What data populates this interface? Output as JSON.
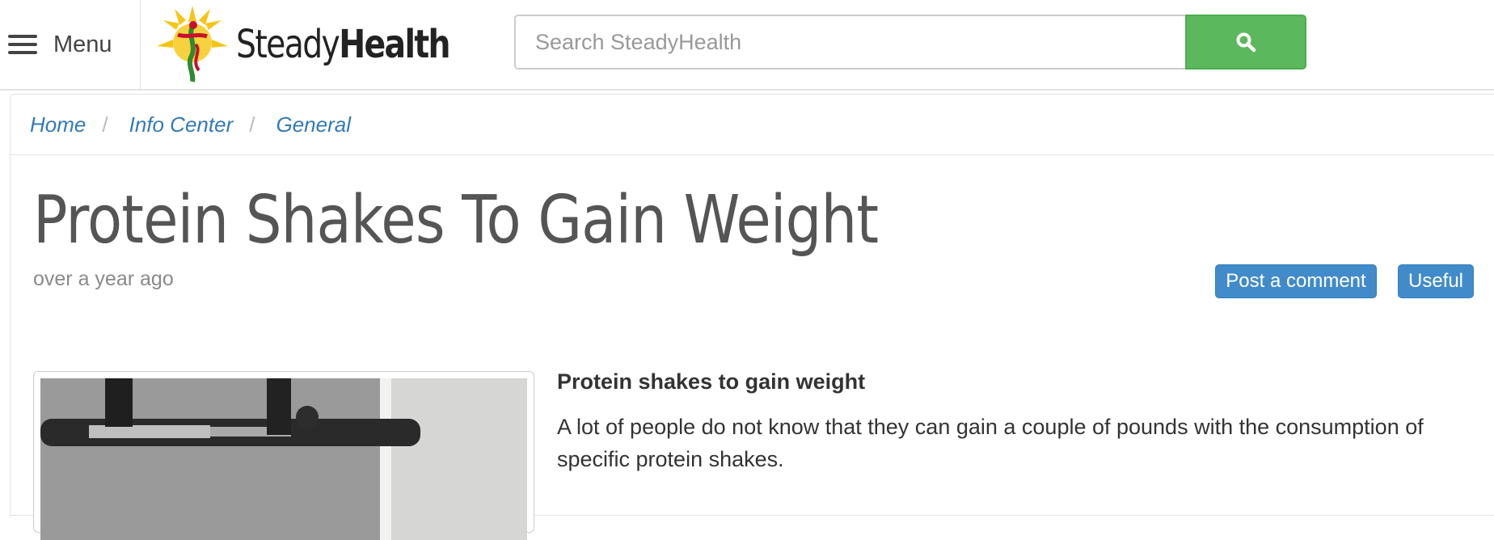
{
  "header": {
    "menu_label": "Menu",
    "logo_text_light": "Steady",
    "logo_text_bold": "Health",
    "search": {
      "placeholder": "Search SteadyHealth",
      "value": ""
    },
    "search_button_icon": "search-icon",
    "colors": {
      "search_button": "#5cb85c",
      "link": "#337ab7"
    }
  },
  "breadcrumb": [
    {
      "label": "Home"
    },
    {
      "label": "Info Center"
    },
    {
      "label": "General"
    }
  ],
  "article": {
    "title": "Protein Shakes To Gain Weight",
    "timestamp": "over a year ago",
    "actions": {
      "post_comment": "Post a comment",
      "useful": "Useful"
    },
    "subheading": "Protein shakes to gain weight",
    "paragraph": "A lot of people do not know that they can gain a couple of pounds with the consumption of specific protein shakes."
  }
}
